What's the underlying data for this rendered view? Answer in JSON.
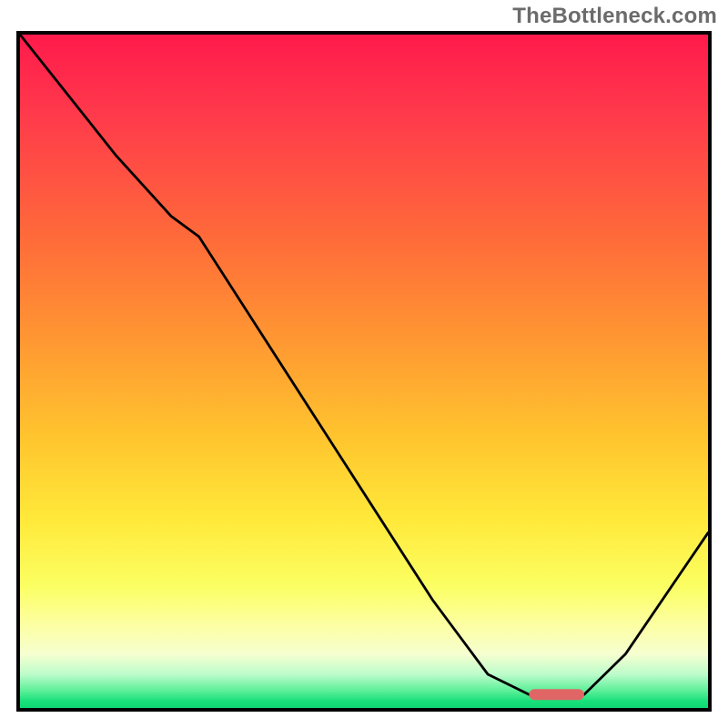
{
  "watermark": "TheBottleneck.com",
  "chart_data": {
    "type": "line",
    "title": "",
    "xlabel": "",
    "ylabel": "",
    "xlim": [
      0,
      100
    ],
    "ylim": [
      0,
      100
    ],
    "grid": false,
    "curve_points": [
      {
        "x": 0,
        "y": 100
      },
      {
        "x": 14,
        "y": 82
      },
      {
        "x": 22,
        "y": 73
      },
      {
        "x": 26,
        "y": 70
      },
      {
        "x": 60,
        "y": 16
      },
      {
        "x": 68,
        "y": 5
      },
      {
        "x": 74,
        "y": 2
      },
      {
        "x": 82,
        "y": 2
      },
      {
        "x": 88,
        "y": 8
      },
      {
        "x": 100,
        "y": 26
      }
    ],
    "optimal_range_floor_x": [
      74,
      82
    ],
    "optimal_range_floor_y": 2,
    "colors": {
      "gradient_top": "#ff1a4b",
      "gradient_mid": "#ffe93a",
      "gradient_bottom": "#0fd873",
      "marker": "#e06666",
      "curve": "#000000",
      "frame": "#000000"
    }
  }
}
